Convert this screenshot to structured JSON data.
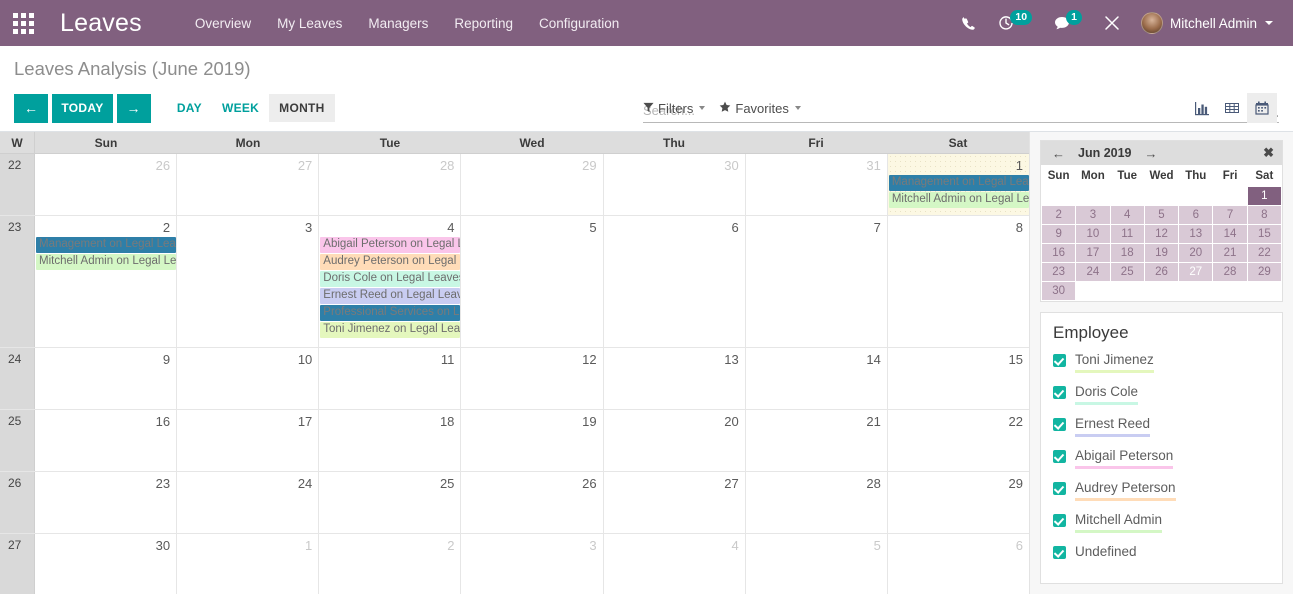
{
  "navbar": {
    "apps_icon": "apps-grid-icon",
    "brand": "Leaves",
    "menu": [
      "Overview",
      "My Leaves",
      "Managers",
      "Reporting",
      "Configuration"
    ],
    "icons": [
      {
        "name": "phone-icon",
        "badge": null
      },
      {
        "name": "activity-clock-icon",
        "badge": "10"
      },
      {
        "name": "messages-icon",
        "badge": "1"
      },
      {
        "name": "tools-icon",
        "badge": null
      }
    ],
    "user": "Mitchell Admin"
  },
  "control_panel": {
    "title": "Leaves Analysis (June 2019)",
    "prev_label": "←",
    "today_label": "TODAY",
    "next_label": "→",
    "scales": [
      {
        "label": "DAY",
        "active": false
      },
      {
        "label": "WEEK",
        "active": false
      },
      {
        "label": "MONTH",
        "active": true
      }
    ],
    "search": {
      "value": "",
      "placeholder": "Search..."
    },
    "filters_label": "Filters",
    "favorites_label": "Favorites",
    "views": [
      {
        "name": "graph-view-icon",
        "active": false
      },
      {
        "name": "list-view-icon",
        "active": false
      },
      {
        "name": "calendar-view-icon",
        "active": true
      }
    ]
  },
  "calendar": {
    "week_header": "W",
    "day_headers": [
      "Sun",
      "Mon",
      "Tue",
      "Wed",
      "Thu",
      "Fri",
      "Sat"
    ],
    "rows": [
      {
        "week": "22",
        "days": [
          {
            "num": "26",
            "other": true,
            "today": false,
            "events": []
          },
          {
            "num": "27",
            "other": true,
            "today": false,
            "events": []
          },
          {
            "num": "28",
            "other": true,
            "today": false,
            "events": []
          },
          {
            "num": "29",
            "other": true,
            "today": false,
            "events": []
          },
          {
            "num": "30",
            "other": true,
            "today": false,
            "events": []
          },
          {
            "num": "31",
            "other": true,
            "today": false,
            "events": []
          },
          {
            "num": "1",
            "other": false,
            "today": true,
            "events": [
              {
                "text": "Management on Legal Leaves",
                "bg": "#2e7fa8",
                "fg": "#7a7a7a"
              },
              {
                "text": "Mitchell Admin on Legal Leaves",
                "bg": "#d4f7c5",
                "fg": "#6d6d6d"
              }
            ]
          }
        ]
      },
      {
        "week": "23",
        "days": [
          {
            "num": "2",
            "other": false,
            "today": false,
            "events": [
              {
                "text": "Management on Legal Leaves",
                "bg": "#2e7fa8",
                "fg": "#7a7a7a"
              },
              {
                "text": "Mitchell Admin on Legal Leaves",
                "bg": "#d4f7c5",
                "fg": "#6d6d6d"
              }
            ]
          },
          {
            "num": "3",
            "other": false,
            "today": false,
            "events": []
          },
          {
            "num": "4",
            "other": false,
            "today": false,
            "events": [
              {
                "text": "Abigail Peterson on Legal Leaves",
                "bg": "#fac5ea",
                "fg": "#6d6d6d"
              },
              {
                "text": "Audrey Peterson on Legal Leaves",
                "bg": "#ffdcb8",
                "fg": "#6d6d6d"
              },
              {
                "text": "Doris Cole on Legal Leaves",
                "bg": "#c8f7e4",
                "fg": "#6d6d6d"
              },
              {
                "text": "Ernest Reed on Legal Leaves",
                "bg": "#c9cdf2",
                "fg": "#6d6d6d"
              },
              {
                "text": "Professional Services on Legal Leaves",
                "bg": "#2e7fa8",
                "fg": "#7a7a7a"
              },
              {
                "text": "Toni Jimenez on Legal Leaves",
                "bg": "#e4f7bd",
                "fg": "#6d6d6d"
              }
            ]
          },
          {
            "num": "5",
            "other": false,
            "today": false,
            "events": []
          },
          {
            "num": "6",
            "other": false,
            "today": false,
            "events": []
          },
          {
            "num": "7",
            "other": false,
            "today": false,
            "events": []
          },
          {
            "num": "8",
            "other": false,
            "today": false,
            "events": []
          }
        ]
      },
      {
        "week": "24",
        "days": [
          {
            "num": "9",
            "other": false,
            "today": false,
            "events": []
          },
          {
            "num": "10",
            "other": false,
            "today": false,
            "events": []
          },
          {
            "num": "11",
            "other": false,
            "today": false,
            "events": []
          },
          {
            "num": "12",
            "other": false,
            "today": false,
            "events": []
          },
          {
            "num": "13",
            "other": false,
            "today": false,
            "events": []
          },
          {
            "num": "14",
            "other": false,
            "today": false,
            "events": []
          },
          {
            "num": "15",
            "other": false,
            "today": false,
            "events": []
          }
        ]
      },
      {
        "week": "25",
        "days": [
          {
            "num": "16",
            "other": false,
            "today": false,
            "events": []
          },
          {
            "num": "17",
            "other": false,
            "today": false,
            "events": []
          },
          {
            "num": "18",
            "other": false,
            "today": false,
            "events": []
          },
          {
            "num": "19",
            "other": false,
            "today": false,
            "events": []
          },
          {
            "num": "20",
            "other": false,
            "today": false,
            "events": []
          },
          {
            "num": "21",
            "other": false,
            "today": false,
            "events": []
          },
          {
            "num": "22",
            "other": false,
            "today": false,
            "events": []
          }
        ]
      },
      {
        "week": "26",
        "days": [
          {
            "num": "23",
            "other": false,
            "today": false,
            "events": []
          },
          {
            "num": "24",
            "other": false,
            "today": false,
            "events": []
          },
          {
            "num": "25",
            "other": false,
            "today": false,
            "events": []
          },
          {
            "num": "26",
            "other": false,
            "today": false,
            "events": []
          },
          {
            "num": "27",
            "other": false,
            "today": false,
            "events": []
          },
          {
            "num": "28",
            "other": false,
            "today": false,
            "events": []
          },
          {
            "num": "29",
            "other": false,
            "today": false,
            "events": []
          }
        ]
      },
      {
        "week": "27",
        "days": [
          {
            "num": "30",
            "other": false,
            "today": false,
            "events": []
          },
          {
            "num": "1",
            "other": true,
            "today": false,
            "events": []
          },
          {
            "num": "2",
            "other": true,
            "today": false,
            "events": []
          },
          {
            "num": "3",
            "other": true,
            "today": false,
            "events": []
          },
          {
            "num": "4",
            "other": true,
            "today": false,
            "events": []
          },
          {
            "num": "5",
            "other": true,
            "today": false,
            "events": []
          },
          {
            "num": "6",
            "other": true,
            "today": false,
            "events": []
          }
        ]
      }
    ]
  },
  "sidebar": {
    "mini_calendar": {
      "prev": "←",
      "title": "Jun 2019",
      "next": "→",
      "close": "✖",
      "day_headers": [
        "Sun",
        "Mon",
        "Tue",
        "Wed",
        "Thu",
        "Fri",
        "Sat"
      ],
      "weeks": [
        [
          {
            "n": "",
            "t": "blank"
          },
          {
            "n": "",
            "t": "blank"
          },
          {
            "n": "",
            "t": "blank"
          },
          {
            "n": "",
            "t": "blank"
          },
          {
            "n": "",
            "t": "blank"
          },
          {
            "n": "",
            "t": "blank"
          },
          {
            "n": "1",
            "t": "sel"
          }
        ],
        [
          {
            "n": "2",
            "t": "inmonth"
          },
          {
            "n": "3",
            "t": "inmonth"
          },
          {
            "n": "4",
            "t": "inmonth"
          },
          {
            "n": "5",
            "t": "inmonth"
          },
          {
            "n": "6",
            "t": "inmonth"
          },
          {
            "n": "7",
            "t": "inmonth"
          },
          {
            "n": "8",
            "t": "inmonth"
          }
        ],
        [
          {
            "n": "9",
            "t": "inmonth"
          },
          {
            "n": "10",
            "t": "inmonth"
          },
          {
            "n": "11",
            "t": "inmonth"
          },
          {
            "n": "12",
            "t": "inmonth"
          },
          {
            "n": "13",
            "t": "inmonth"
          },
          {
            "n": "14",
            "t": "inmonth"
          },
          {
            "n": "15",
            "t": "inmonth"
          }
        ],
        [
          {
            "n": "16",
            "t": "inmonth"
          },
          {
            "n": "17",
            "t": "inmonth"
          },
          {
            "n": "18",
            "t": "inmonth"
          },
          {
            "n": "19",
            "t": "inmonth"
          },
          {
            "n": "20",
            "t": "inmonth"
          },
          {
            "n": "21",
            "t": "inmonth"
          },
          {
            "n": "22",
            "t": "inmonth"
          }
        ],
        [
          {
            "n": "23",
            "t": "inmonth"
          },
          {
            "n": "24",
            "t": "inmonth"
          },
          {
            "n": "25",
            "t": "inmonth"
          },
          {
            "n": "26",
            "t": "inmonth"
          },
          {
            "n": "27",
            "t": "today-mc"
          },
          {
            "n": "28",
            "t": "inmonth"
          },
          {
            "n": "29",
            "t": "inmonth"
          }
        ],
        [
          {
            "n": "30",
            "t": "inmonth"
          },
          {
            "n": "",
            "t": "blank"
          },
          {
            "n": "",
            "t": "blank"
          },
          {
            "n": "",
            "t": "blank"
          },
          {
            "n": "",
            "t": "blank"
          },
          {
            "n": "",
            "t": "blank"
          },
          {
            "n": "",
            "t": "blank"
          }
        ]
      ]
    },
    "filter_panel": {
      "title": "Employee",
      "items": [
        {
          "label": "Toni Jimenez",
          "color": "#e4f7bd",
          "checked": true
        },
        {
          "label": "Doris Cole",
          "color": "#c8f7e4",
          "checked": true
        },
        {
          "label": "Ernest Reed",
          "color": "#c9cdf2",
          "checked": true
        },
        {
          "label": "Abigail Peterson",
          "color": "#fac5ea",
          "checked": true
        },
        {
          "label": "Audrey Peterson",
          "color": "#ffdcb8",
          "checked": true
        },
        {
          "label": "Mitchell Admin",
          "color": "#d4f7c5",
          "checked": true
        },
        {
          "label": "Undefined",
          "color": "",
          "checked": true
        }
      ]
    }
  },
  "colors": {
    "brand_purple": "#81607f",
    "accent_teal": "#00a09d",
    "today_bg": "#fcf8e3"
  }
}
